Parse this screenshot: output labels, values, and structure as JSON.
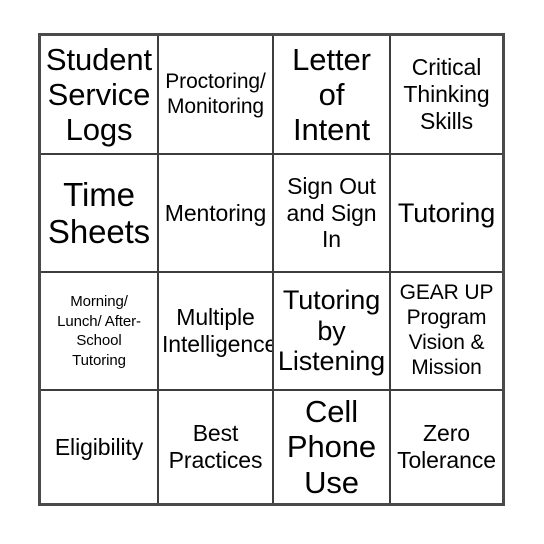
{
  "card": {
    "type": "bingo-card",
    "columns": 4,
    "rows": 4,
    "border_color": "#4a4a4a",
    "divider_color": "#3d3d3d",
    "background_color": "#ffffff",
    "text_color": "#000000",
    "cells": [
      {
        "id": "r1c1",
        "row": 1,
        "col": 1,
        "text": "Student\nService\nLogs",
        "size": "fs-xl"
      },
      {
        "id": "r1c2",
        "row": 1,
        "col": 2,
        "text": "Proctoring/\nMonitoring",
        "size": "fs-sm"
      },
      {
        "id": "r1c3",
        "row": 1,
        "col": 3,
        "text": "Letter\nof\nIntent",
        "size": "fs-xl"
      },
      {
        "id": "r1c4",
        "row": 1,
        "col": 4,
        "text": "Critical\nThinking\nSkills",
        "size": "fs-md"
      },
      {
        "id": "r2c1",
        "row": 2,
        "col": 1,
        "text": "Time\nSheets",
        "size": "fs-xxl"
      },
      {
        "id": "r2c2",
        "row": 2,
        "col": 2,
        "text": "Mentoring",
        "size": "fs-md"
      },
      {
        "id": "r2c3",
        "row": 2,
        "col": 3,
        "text": "Sign Out\nand Sign\nIn",
        "size": "fs-md"
      },
      {
        "id": "r2c4",
        "row": 2,
        "col": 4,
        "text": "Tutoring",
        "size": "fs-lg"
      },
      {
        "id": "r3c1",
        "row": 3,
        "col": 1,
        "text": "Morning/\nLunch/ After-\nSchool\nTutoring",
        "size": "fs-xs"
      },
      {
        "id": "r3c2",
        "row": 3,
        "col": 2,
        "text": "Multiple\nIntelligence",
        "size": "fs-md"
      },
      {
        "id": "r3c3",
        "row": 3,
        "col": 3,
        "text": "Tutoring\nby\nListening",
        "size": "fs-lg"
      },
      {
        "id": "r3c4",
        "row": 3,
        "col": 4,
        "text": "GEAR UP\nProgram\nVision &\nMission",
        "size": "fs-sm"
      },
      {
        "id": "r4c1",
        "row": 4,
        "col": 1,
        "text": "Eligibility",
        "size": "fs-md"
      },
      {
        "id": "r4c2",
        "row": 4,
        "col": 2,
        "text": "Best\nPractices",
        "size": "fs-md"
      },
      {
        "id": "r4c3",
        "row": 4,
        "col": 3,
        "text": "Cell\nPhone\nUse",
        "size": "fs-xl"
      },
      {
        "id": "r4c4",
        "row": 4,
        "col": 4,
        "text": "Zero\nTolerance",
        "size": "fs-md"
      }
    ]
  }
}
